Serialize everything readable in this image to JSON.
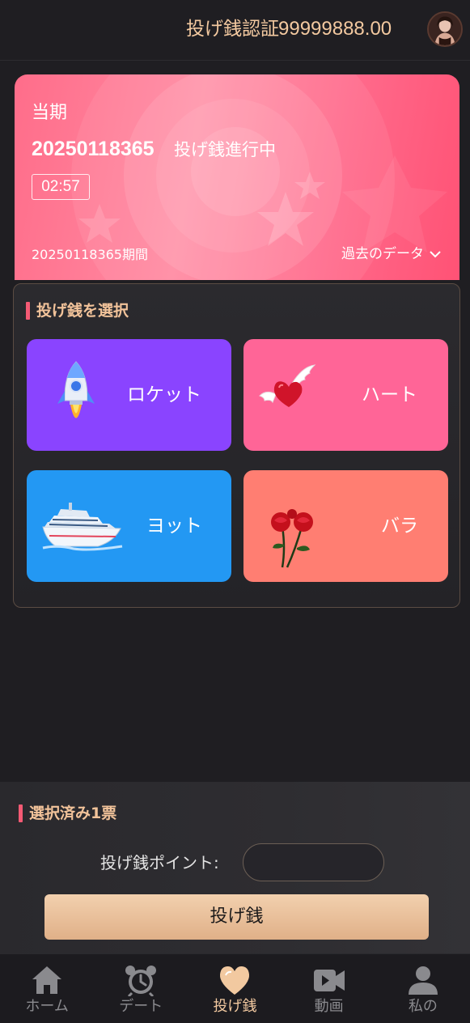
{
  "header": {
    "title": "投げ銭認証",
    "balance": "99999888.00",
    "avatar_icon": "user-avatar-icon"
  },
  "banner": {
    "period_label": "当期",
    "issue": "20250118365",
    "status": "投げ銭進行中",
    "timer": "02:57",
    "period": "20250118365期間",
    "history_link": "過去のデータ",
    "colors": {
      "start": "#ff6d8a",
      "end": "#ff5275"
    }
  },
  "select": {
    "title": "投げ銭を選択",
    "gifts": [
      {
        "label": "ロケット",
        "icon": "rocket-icon",
        "color": "#8a44ff"
      },
      {
        "label": "ハート",
        "icon": "winged-heart-icon",
        "color": "#ff6597"
      },
      {
        "label": "ヨット",
        "icon": "yacht-icon",
        "color": "#2398f3"
      },
      {
        "label": "バラ",
        "icon": "rose-icon",
        "color": "#ff7e72"
      }
    ]
  },
  "bet": {
    "selected_title": "選択済み1票",
    "points_label": "投げ銭ポイント:",
    "points_value": "",
    "points_placeholder": "",
    "button_label": "投げ銭"
  },
  "nav": {
    "items": [
      {
        "label": "ホーム",
        "icon": "home-icon",
        "active": false
      },
      {
        "label": "デート",
        "icon": "alarm-clock-icon",
        "active": false
      },
      {
        "label": "投げ銭",
        "icon": "heart-icon",
        "active": true
      },
      {
        "label": "動画",
        "icon": "video-icon",
        "active": false
      },
      {
        "label": "私の",
        "icon": "user-icon",
        "active": false
      }
    ]
  },
  "colors": {
    "accent": "#f3c9a0",
    "title_bar": "#f45a74",
    "background": "#1f1e22"
  }
}
